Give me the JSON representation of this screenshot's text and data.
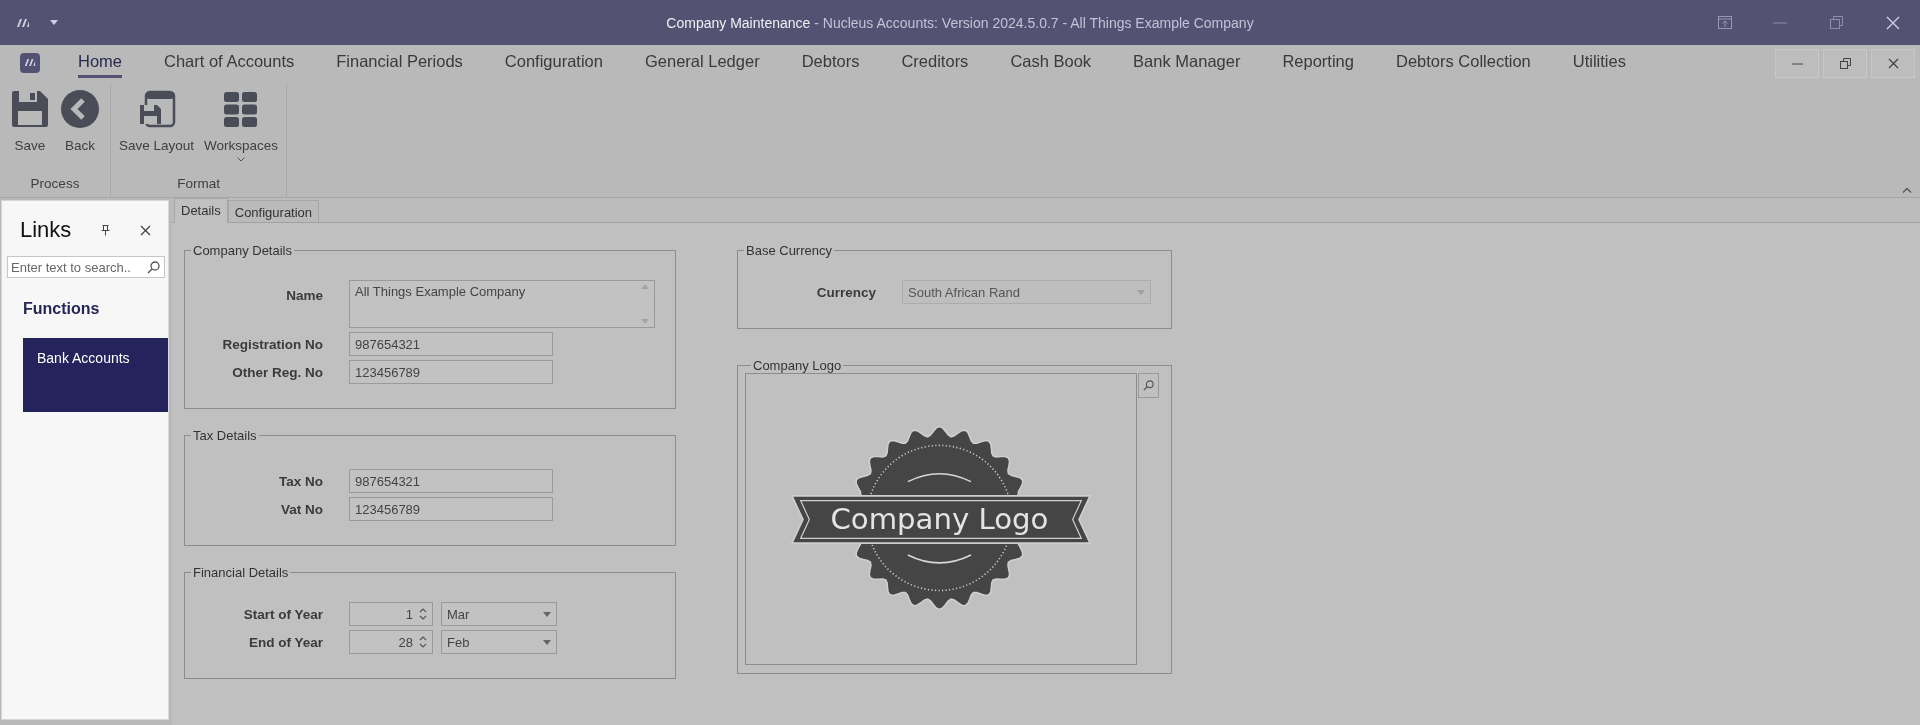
{
  "window": {
    "title": "Company Maintenance",
    "title_suffix": "- Nucleus Accounts: Version 2024.5.0.7 - All Things Example Company"
  },
  "menu": [
    {
      "label": "Home",
      "selected": true
    },
    {
      "label": "Chart of Accounts",
      "selected": false
    },
    {
      "label": "Financial Periods",
      "selected": false
    },
    {
      "label": "Configuration",
      "selected": false
    },
    {
      "label": "General Ledger",
      "selected": false
    },
    {
      "label": "Debtors",
      "selected": false
    },
    {
      "label": "Creditors",
      "selected": false
    },
    {
      "label": "Cash Book",
      "selected": false
    },
    {
      "label": "Bank Manager",
      "selected": false
    },
    {
      "label": "Reporting",
      "selected": false
    },
    {
      "label": "Debtors Collection",
      "selected": false
    },
    {
      "label": "Utilities",
      "selected": false
    }
  ],
  "ribbon": {
    "groups": [
      {
        "label": "Process",
        "buttons": [
          {
            "label": "Save",
            "kind": "save"
          },
          {
            "label": "Back",
            "kind": "back"
          }
        ]
      },
      {
        "label": "Format",
        "buttons": [
          {
            "label": "Save Layout",
            "kind": "layout"
          },
          {
            "label": "Workspaces",
            "kind": "workspaces"
          }
        ]
      }
    ]
  },
  "links_panel": {
    "title": "Links",
    "search": {
      "placeholder": "Enter text to search.."
    },
    "section": "Functions",
    "items": [
      {
        "label": "Bank Accounts",
        "selected": true
      }
    ]
  },
  "tabs": [
    {
      "label": "Details",
      "selected": true
    },
    {
      "label": "Configuration",
      "selected": false
    }
  ],
  "left_groups": [
    {
      "title": "Company Details",
      "fields": [
        {
          "kind": "memo",
          "label": "Name",
          "value": "All Things Example Company"
        },
        {
          "kind": "text",
          "label": "Registration No",
          "value": "987654321"
        },
        {
          "kind": "text",
          "label": "Other Reg. No",
          "value": "123456789"
        }
      ]
    },
    {
      "title": "Tax Details",
      "fields": [
        {
          "kind": "text",
          "label": "Tax No",
          "value": "987654321"
        },
        {
          "kind": "text",
          "label": "Vat No",
          "value": "123456789"
        }
      ]
    },
    {
      "title": "Financial Details",
      "fields": [
        {
          "kind": "day_month",
          "label": "Start of Year",
          "day": "1",
          "month": "Mar"
        },
        {
          "kind": "day_month",
          "label": "End of Year",
          "day": "28",
          "month": "Feb"
        }
      ]
    }
  ],
  "base_currency": {
    "title": "Base Currency",
    "fields": [
      {
        "kind": "combo",
        "label": "Currency",
        "value": "South African Rand"
      }
    ]
  },
  "company_logo": {
    "title": "Company Logo",
    "logo_text": "Company Logo"
  }
}
